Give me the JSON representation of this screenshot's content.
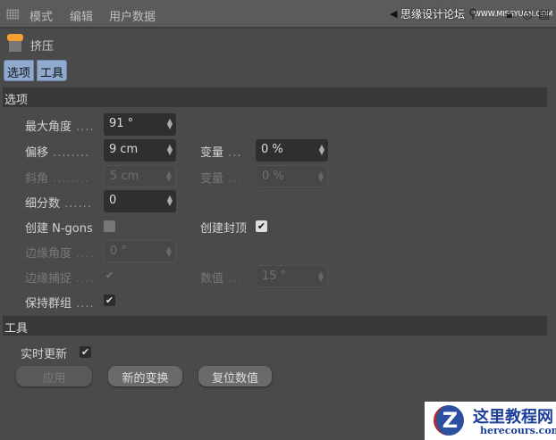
{
  "menu": [
    "模式",
    "编辑",
    "用户数据"
  ],
  "watermark": {
    "text": "思缘设计论坛",
    "url": "WWW.MISSYUAN.COM"
  },
  "object": {
    "name": "挤压"
  },
  "tabs": [
    "选项",
    "工具"
  ],
  "sections": {
    "options": "选项",
    "tools": "工具"
  },
  "fields": {
    "max_angle": {
      "label": "最大角度",
      "value": "91 °"
    },
    "offset": {
      "label": "偏移",
      "value": "9 cm"
    },
    "offset_var": {
      "label": "变量",
      "value": "0 %"
    },
    "bevel": {
      "label": "斜角",
      "value": "5 cm"
    },
    "bevel_var": {
      "label": "变量",
      "value": "0 %"
    },
    "subdiv": {
      "label": "细分数",
      "value": "0"
    },
    "ngons": {
      "label": "创建 N-gons",
      "checked": false
    },
    "caps": {
      "label": "创建封顶",
      "checked": true
    },
    "edge_angle": {
      "label": "边缘角度",
      "value": "0 °"
    },
    "edge_snap": {
      "label": "边缘捕捉",
      "checked": true
    },
    "snap_value": {
      "label": "数值",
      "value": "15 °"
    },
    "preserve_groups": {
      "label": "保持群组",
      "checked": true
    }
  },
  "tools": {
    "realtime": {
      "label": "实时更新",
      "checked": true
    },
    "apply": "应用",
    "new_transform": "新的变换",
    "reset": "复位数值"
  },
  "logo": {
    "title": "这里教程网",
    "url": "herecours.com"
  }
}
